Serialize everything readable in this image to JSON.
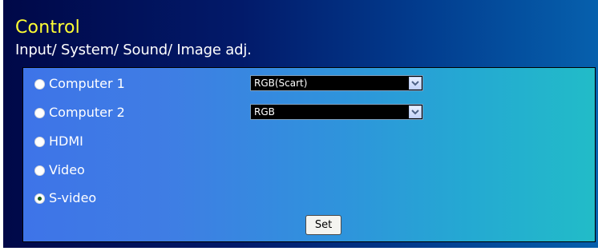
{
  "header": {
    "title": "Control",
    "subtitle": "Input/ System/ Sound/ Image adj."
  },
  "inputs": [
    {
      "label": "Computer 1",
      "selected": false,
      "dropdown_value": "RGB(Scart)"
    },
    {
      "label": "Computer 2",
      "selected": false,
      "dropdown_value": "RGB"
    },
    {
      "label": "HDMI",
      "selected": false
    },
    {
      "label": "Video",
      "selected": false
    },
    {
      "label": "S-video",
      "selected": true
    }
  ],
  "set_button_label": "Set",
  "colors": {
    "title": "#ffff33",
    "subtitle": "#ffffff",
    "panel_left": "#000848",
    "panel_right": "#0660ad",
    "form_left": "#3e74e8",
    "form_right": "#22bcc8",
    "radio_dot": "#1a5c1a",
    "dropdown_bg": "#000000"
  },
  "icons": {
    "dropdown_arrow": "chevron-down-icon"
  }
}
